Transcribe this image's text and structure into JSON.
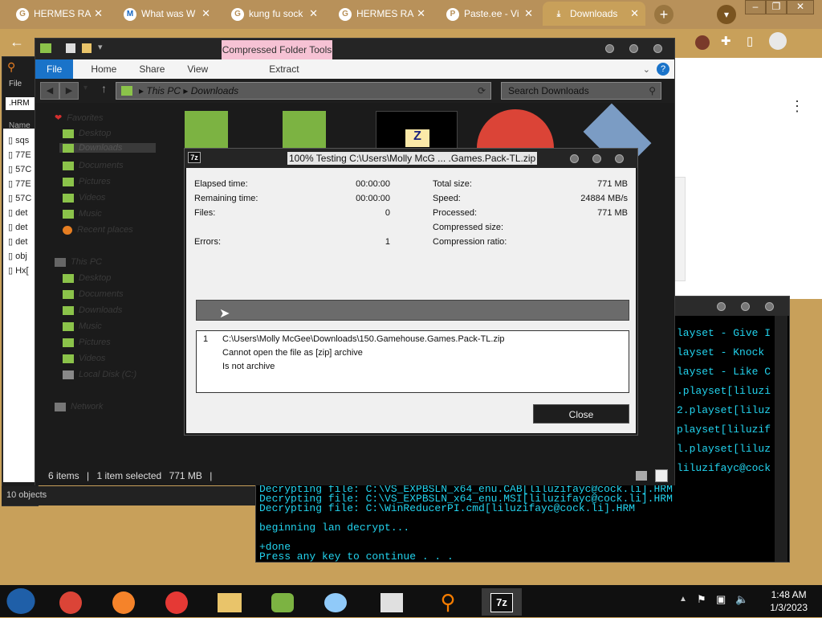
{
  "browser": {
    "tabs": [
      {
        "label": "HERMES RA"
      },
      {
        "label": "What was W"
      },
      {
        "label": "kung fu sock"
      },
      {
        "label": "HERMES RA"
      },
      {
        "label": "Paste.ee - Vi"
      },
      {
        "label": "Downloads"
      }
    ],
    "new_tab": "+"
  },
  "bg_explorer": {
    "menu": "File",
    "search_value": ".HRM",
    "header": "Name",
    "rows": [
      "sqs",
      "77E",
      "57C",
      "77E",
      "57C",
      "det",
      "det",
      "det",
      "obj",
      "Hx["
    ],
    "status": "10 objects"
  },
  "console": {
    "lines_right": [
      "layset - Give I",
      "layset - Knock",
      "layset - Like C",
      ".playset[liluzi",
      "2.playset[liluz",
      "playset[liluzif",
      "l.playset[liluz",
      "liluzifayc@cock"
    ],
    "lines": [
      "Decrypting file: C:\\VS_EXPBSLN_x64_enu.CAB[liluzifayc@cock.li].HRM",
      "Decrypting file: C:\\VS_EXPBSLN_x64_enu.MSI[liluzifayc@cock.li].HRM",
      "Decrypting file: C:\\WinReducerPI.cmd[liluzifayc@cock.li].HRM",
      "",
      "beginning lan decrypt...",
      "",
      "+done",
      "Press any key to continue . . ."
    ]
  },
  "explorer": {
    "context_tab": "Compressed Folder Tools",
    "ribbon": {
      "file": "File",
      "home": "Home",
      "share": "Share",
      "view": "View",
      "extract": "Extract"
    },
    "address": {
      "root": "This PC",
      "current": "Downloads"
    },
    "search_placeholder": "Search Downloads",
    "favorites_label": "Favorites",
    "favorites": [
      "Desktop",
      "Downloads",
      "Documents",
      "Pictures",
      "Videos",
      "Music",
      "Recent places"
    ],
    "thispc_label": "This PC",
    "thispc": [
      "Desktop",
      "Documents",
      "Downloads",
      "Music",
      "Pictures",
      "Videos",
      "Local Disk (C:)"
    ],
    "network": "Network",
    "status": {
      "items": "6 items",
      "selected": "1 item selected",
      "size": "771 MB"
    }
  },
  "dialog": {
    "title": "100% Testing C:\\Users\\Molly McG ... .Games.Pack-TL.zip",
    "icon": "7z",
    "stats_left": [
      {
        "label": "Elapsed time:",
        "value": "00:00:00"
      },
      {
        "label": "Remaining time:",
        "value": "00:00:00"
      },
      {
        "label": "Files:",
        "value": "0"
      },
      {
        "label": "",
        "value": ""
      },
      {
        "label": "Errors:",
        "value": "1"
      }
    ],
    "stats_right": [
      {
        "label": "Total size:",
        "value": "771 MB"
      },
      {
        "label": "Speed:",
        "value": "24884 MB/s"
      },
      {
        "label": "Processed:",
        "value": "771 MB"
      },
      {
        "label": "Compressed size:",
        "value": ""
      },
      {
        "label": "Compression ratio:",
        "value": ""
      }
    ],
    "log": {
      "index": "1",
      "path": "C:\\Users\\Molly McGee\\Downloads\\150.Gamehouse.Games.Pack-TL.zip",
      "line2": "Cannot open the file as [zip] archive",
      "line3": "Is not archive"
    },
    "close_label": "Close"
  },
  "taskbar": {
    "time": "1:48 AM",
    "date": "1/3/2023",
    "apps": [
      "windows-start",
      "chrome",
      "firefox",
      "opera",
      "file-explorer",
      "users",
      "paint",
      "notepad",
      "search",
      "7zip"
    ]
  },
  "colors": {
    "console_text": "#22d3ee",
    "ribbon_file": "#1a73c9",
    "context_tab": "#f6c2d4"
  }
}
